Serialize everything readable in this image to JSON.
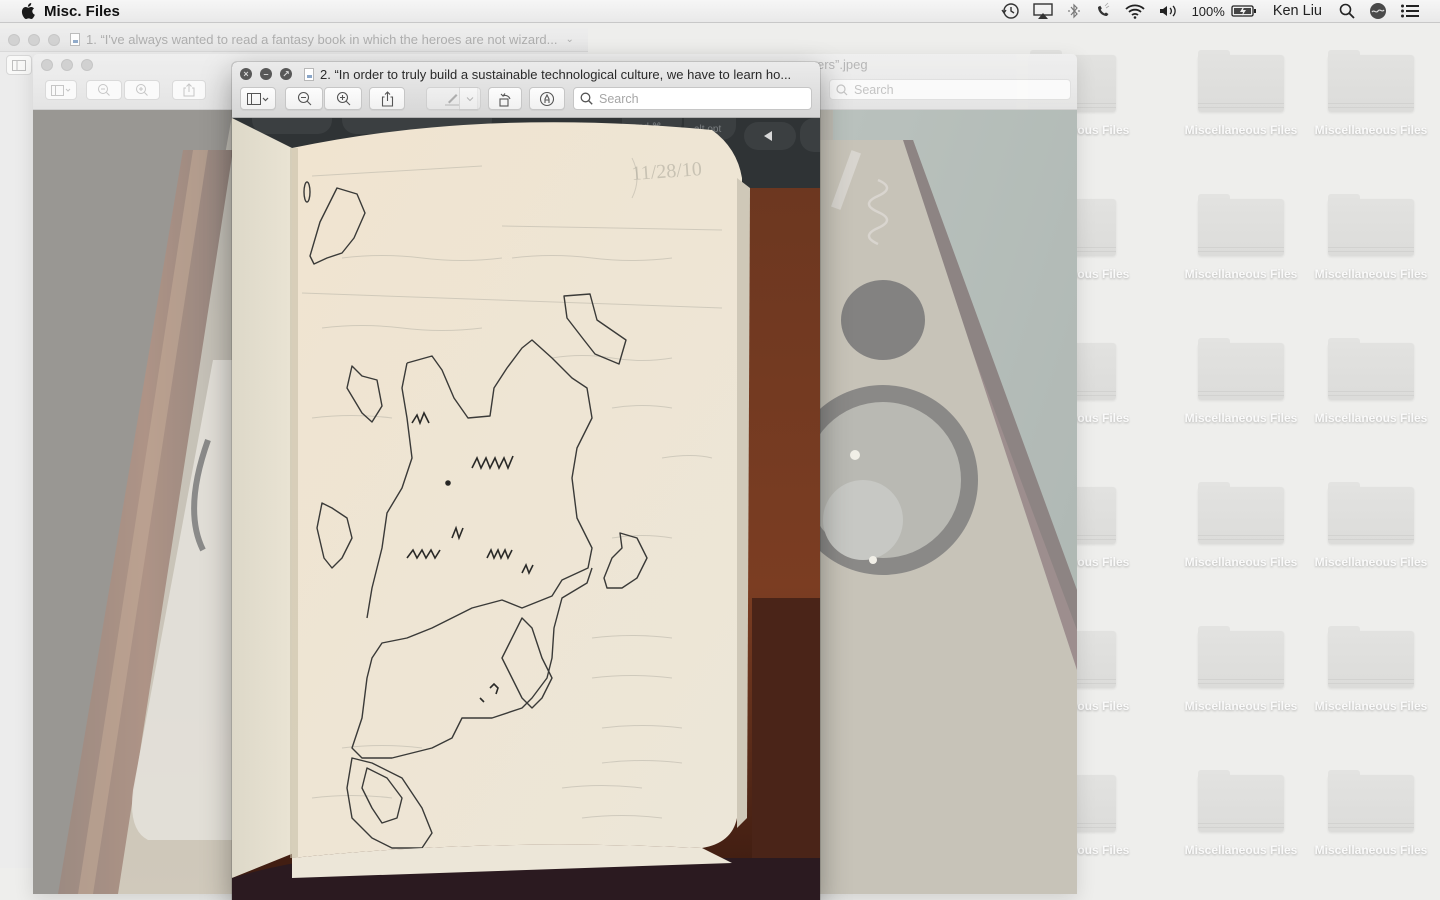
{
  "menubar": {
    "app_name": "Misc. Files",
    "battery_percent": "100%",
    "user_name": "Ken Liu",
    "icons": [
      "apple-logo-icon",
      "time-machine-icon",
      "airplay-icon",
      "bluetooth-icon",
      "phone-icon",
      "wifi-icon",
      "volume-icon",
      "battery-charging-icon",
      "spotlight-search-icon",
      "siri-icon",
      "notification-center-icon"
    ]
  },
  "background_window_1": {
    "title": "1. “I've always wanted to read a fantasy book in which the heroes are not wizard...",
    "title_dropdown_icon": "chevron-down-icon"
  },
  "background_window_2": {
    "title_visible_tail": "ers”.jpeg",
    "search_placeholder": "Search",
    "toolbar_icons": [
      "sidebar-icon",
      "zoom-out-icon",
      "zoom-in-icon",
      "share-icon"
    ]
  },
  "active_window": {
    "title": "2. “In order to truly build a sustainable technological culture, we have to learn ho...",
    "toolbar": {
      "sidebar": "sidebar-icon",
      "zoom_out": "zoom-out-icon",
      "zoom_in": "zoom-in-icon",
      "share": "share-icon",
      "markup_pen": "pen-icon",
      "markup_dropdown": "chevron-down-icon",
      "rotate": "rotate-left-icon",
      "annotate": "markup-toolbox-icon"
    },
    "search": {
      "placeholder": "Search",
      "value": ""
    },
    "photo": {
      "description": "Notebook page with hand-drawn fantasy map sketch",
      "keyboard_keys": [
        "cmd ⌘",
        "alt opt",
        "◀"
      ],
      "page_date": "11/28/10"
    }
  },
  "desktop": {
    "folder_label": "Miscellaneous Files",
    "folders": [
      {
        "label": "Miscellaneous Files"
      },
      {
        "label": "Miscellaneous Files"
      },
      {
        "label": "Miscellaneous Files"
      },
      {
        "label": "Miscellaneous Files"
      },
      {
        "label": "Miscellaneous Files"
      },
      {
        "label": "Miscellaneous Files"
      },
      {
        "label": "Miscellaneous Files"
      },
      {
        "label": "Miscellaneous Files"
      },
      {
        "label": "Miscellaneous Files"
      },
      {
        "label": "Miscellaneous Files"
      },
      {
        "label": "Miscellaneous Files"
      },
      {
        "label": "Miscellaneous Files"
      },
      {
        "label": "Miscellaneous Files"
      },
      {
        "label": "Miscellaneous Files"
      },
      {
        "label": "Miscellaneous Files"
      },
      {
        "label": "Miscellaneous Files"
      },
      {
        "label": "Miscellaneous Files"
      },
      {
        "label": "Miscellaneous Files"
      }
    ]
  }
}
